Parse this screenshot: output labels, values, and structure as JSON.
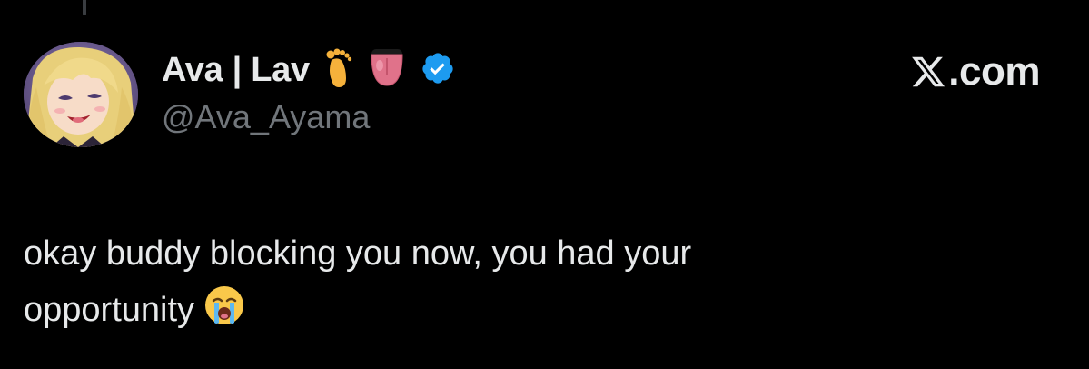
{
  "tweet": {
    "author": {
      "display_name": "Ava | Lav",
      "handle": "@Ava_Ayama",
      "name_emojis": [
        "foot-emoji",
        "tongue-emoji"
      ],
      "verified": true,
      "verified_color": "#1d9bf0"
    },
    "brand_label": ".com",
    "text_lines": [
      "okay buddy blocking you now, you had your",
      "opportunity"
    ],
    "trailing_emoji": "loudly-crying-face-emoji"
  },
  "colors": {
    "background": "#000000",
    "text": "#e7e9ea",
    "secondary_text": "#71767b"
  }
}
